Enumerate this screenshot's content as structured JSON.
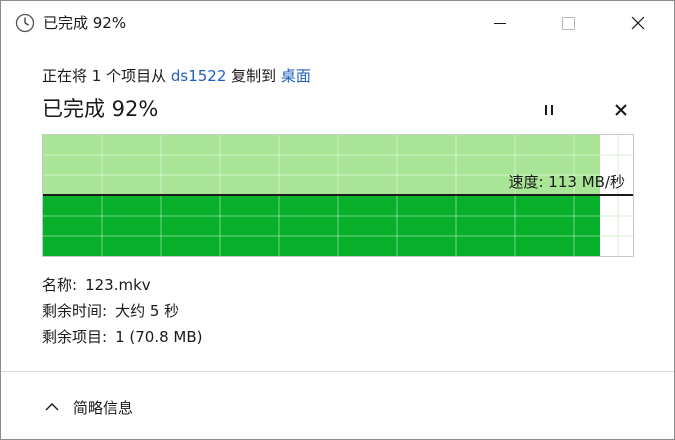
{
  "window": {
    "title": "已完成 92%",
    "icon": "clock-icon"
  },
  "caption_buttons": {
    "minimize": "minimize-icon",
    "maximize": "maximize-icon",
    "close": "close-icon"
  },
  "status": {
    "prefix": "正在将 1 个项目从 ",
    "source": "ds1522",
    "middle": " 复制到 ",
    "destination": "桌面"
  },
  "heading": "已完成 92%",
  "progress_percent": 92,
  "controls": {
    "pause": "pause-icon",
    "cancel": "close-icon"
  },
  "speed": {
    "label": "速度: 113 MB/秒"
  },
  "details": {
    "name_label": "名称:",
    "name_value": "123.mkv",
    "time_label": "剩余时间:",
    "time_value": "大约 5 秒",
    "items_label": "剩余项目:",
    "items_value": "1 (70.8 MB)"
  },
  "footer": {
    "toggle_label": "简略信息",
    "icon": "chevron-up-icon"
  },
  "colors": {
    "link": "#1f5fbf",
    "progress_light": "#a8e596",
    "progress_dark": "#06b02a"
  }
}
